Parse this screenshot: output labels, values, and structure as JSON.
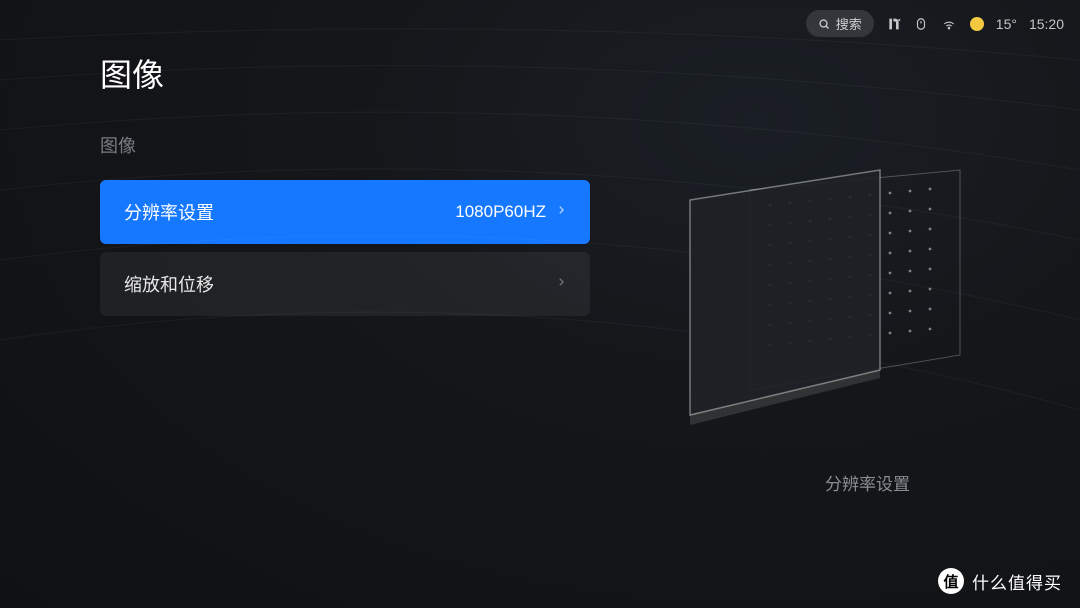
{
  "statusbar": {
    "search_label": "搜索",
    "temperature": "15°",
    "time": "15:20"
  },
  "page": {
    "title": "图像",
    "section_label": "图像"
  },
  "settings": {
    "resolution": {
      "label": "分辨率设置",
      "value": "1080P60HZ"
    },
    "scale": {
      "label": "缩放和位移"
    }
  },
  "preview": {
    "caption": "分辨率设置"
  },
  "watermark": {
    "badge": "值",
    "text": "什么值得买"
  },
  "colors": {
    "accent": "#1677ff",
    "weather": "#f5c842"
  }
}
